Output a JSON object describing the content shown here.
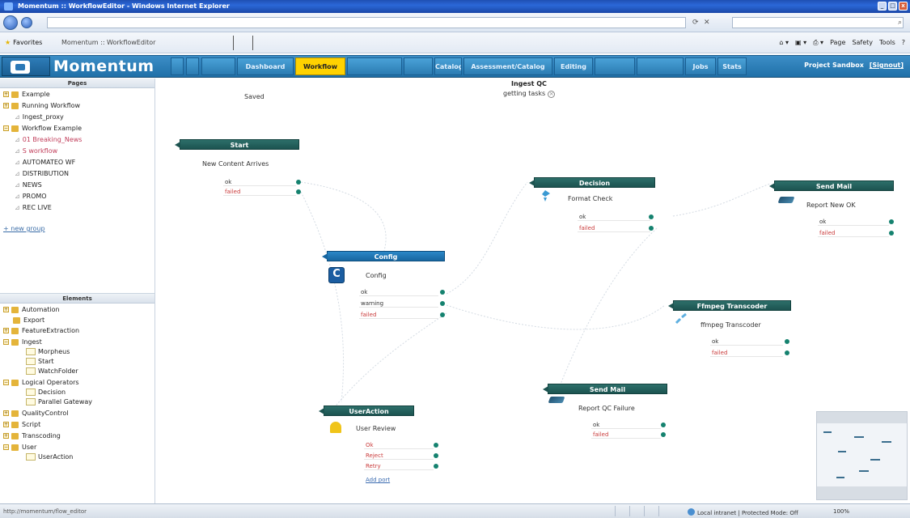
{
  "window": {
    "title": "Momentum :: WorkflowEditor - Windows Internet Explorer"
  },
  "browser": {
    "favorites_label": "Favorites",
    "tab_title": "Momentum :: WorkflowEditor",
    "toolbar": [
      "Page",
      "Safety",
      "Tools"
    ]
  },
  "app": {
    "brand": "Momentum",
    "nav_tabs": [
      {
        "label": "Dashboard",
        "active": false
      },
      {
        "label": "Workflow",
        "active": true
      },
      {
        "label": "Catalog",
        "active": false
      },
      {
        "label": "Assessment/Catalog",
        "active": false
      },
      {
        "label": "Editing",
        "active": false
      },
      {
        "label": "Jobs",
        "active": false
      },
      {
        "label": "Stats",
        "active": false
      }
    ],
    "project_label": "Project Sandbox",
    "signout_label": "[Signout]"
  },
  "pages_panel": {
    "header": "Pages",
    "items": [
      {
        "label": "Example",
        "type": "group"
      },
      {
        "label": "Running Workflow",
        "type": "group"
      },
      {
        "label": "Ingest_proxy",
        "type": "page"
      },
      {
        "label": "Workflow Example",
        "type": "group"
      },
      {
        "label": "01 Breaking_News",
        "type": "page-pink"
      },
      {
        "label": "S workflow",
        "type": "page-pink"
      },
      {
        "label": "AUTOMATEO WF",
        "type": "page"
      },
      {
        "label": "DISTRIBUTION",
        "type": "page"
      },
      {
        "label": "NEWS",
        "type": "page"
      },
      {
        "label": "PROMO",
        "type": "page"
      },
      {
        "label": "REC LIVE",
        "type": "page"
      }
    ],
    "new_group_label": "+ new group"
  },
  "elements_panel": {
    "header": "Elements",
    "items": [
      {
        "label": "Automation",
        "type": "group"
      },
      {
        "label": "Export",
        "type": "group"
      },
      {
        "label": "FeatureExtraction",
        "type": "group"
      },
      {
        "label": "Ingest",
        "type": "group"
      },
      {
        "label": "Morpheus",
        "type": "element"
      },
      {
        "label": "Start",
        "type": "element"
      },
      {
        "label": "WatchFolder",
        "type": "element"
      },
      {
        "label": "Logical Operators",
        "type": "group"
      },
      {
        "label": "Decision",
        "type": "element"
      },
      {
        "label": "Parallel Gateway",
        "type": "element"
      },
      {
        "label": "QualityControl",
        "type": "group"
      },
      {
        "label": "Script",
        "type": "group"
      },
      {
        "label": "Transcoding",
        "type": "group"
      },
      {
        "label": "User",
        "type": "group"
      },
      {
        "label": "UserAction",
        "type": "element"
      }
    ]
  },
  "canvas": {
    "workflow_title": "Ingest QC",
    "status": "getting tasks",
    "saved_label": "Saved",
    "nodes": {
      "start": {
        "header": "Start",
        "text": "New Content Arrives",
        "ports": [
          "ok",
          "failed"
        ]
      },
      "decision": {
        "header": "Decision",
        "text": "Format Check",
        "ports": [
          "ok",
          "failed"
        ]
      },
      "send_mail_ok": {
        "header": "Send Mail",
        "text": "Report New OK",
        "ports": [
          "ok",
          "failed"
        ]
      },
      "config": {
        "header": "Config",
        "text": "Config",
        "ports": [
          "ok",
          "warning",
          "failed"
        ]
      },
      "ffmpeg": {
        "header": "Ffmpeg Transcoder",
        "text": "ffmpeg Transcoder",
        "ports": [
          "ok",
          "failed"
        ]
      },
      "send_mail_fail": {
        "header": "Send Mail",
        "text": "Report QC Failure",
        "ports": [
          "ok",
          "failed"
        ]
      },
      "user_action": {
        "header": "UserAction",
        "text": "User Review",
        "ports": [
          "Ok",
          "Reject",
          "Retry"
        ],
        "add_port": "Add port"
      }
    }
  },
  "statusbar": {
    "left": "http://momentum/flow_editor",
    "zone": "Local intranet | Protected Mode: Off",
    "zoom": "100%"
  },
  "colors": {
    "nav_active": "#ffd200",
    "node_header": "#1c5350",
    "node_header_blue": "#1766a0",
    "port_dot": "#15826f"
  }
}
